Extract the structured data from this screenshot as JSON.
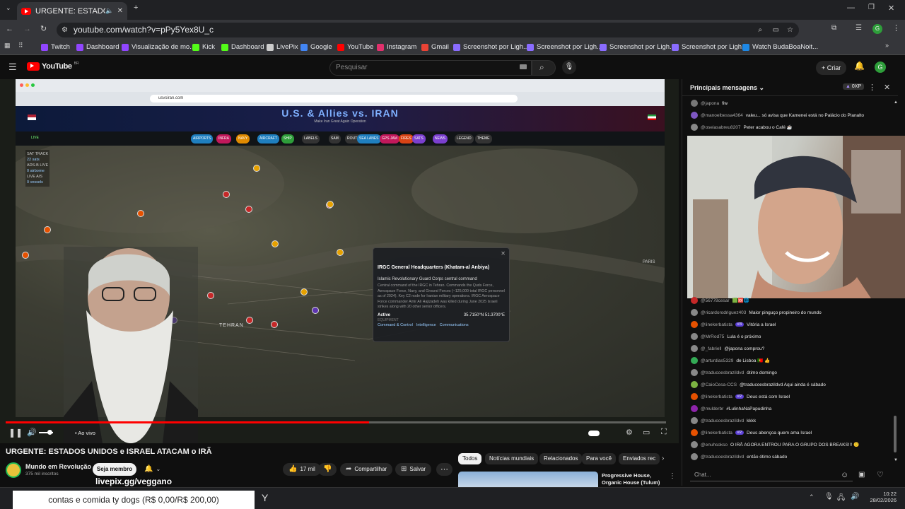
{
  "browser": {
    "tab_title": "URGENTE: ESTADOS UNIDOS",
    "url": "youtube.com/watch?v=pPy5Yex8U_c",
    "bookmarks": [
      {
        "label": "Twitch",
        "color": "#9146ff"
      },
      {
        "label": "Dashboard",
        "color": "#9146ff"
      },
      {
        "label": "Visualização de mo...",
        "color": "#9146ff"
      },
      {
        "label": "Kick",
        "color": "#53fc18"
      },
      {
        "label": "Dashboard",
        "color": "#53fc18"
      },
      {
        "label": "LivePix",
        "color": "#cccccc"
      },
      {
        "label": "Google",
        "color": "#4285f4"
      },
      {
        "label": "YouTube",
        "color": "#ff0000"
      },
      {
        "label": "Instagram",
        "color": "#e1306c"
      },
      {
        "label": "Gmail",
        "color": "#ea4335"
      },
      {
        "label": "Screenshot por Ligh...",
        "color": "#8a6cff"
      },
      {
        "label": "Screenshot por Ligh...",
        "color": "#8a6cff"
      },
      {
        "label": "Screenshot por Ligh...",
        "color": "#8a6cff"
      },
      {
        "label": "Screenshot por Ligh...",
        "color": "#8a6cff"
      },
      {
        "label": "Watch BudaBoaNoit...",
        "color": "#1e88e5"
      }
    ]
  },
  "youtube": {
    "logo": "YouTube",
    "search_placeholder": "Pesquisar",
    "create_label": "Criar",
    "account_initial": "G"
  },
  "stream": {
    "inner_url": "usvsiran.com",
    "map_title": "U.S. & Allies vs. IRAN",
    "map_subtitle": "Make Iran Great Again Operation",
    "live_label": "LIVE",
    "layer_pills": [
      {
        "label": "AIRPORTS",
        "color": "#1f7fbf"
      },
      {
        "label": "INFRA",
        "color": "#c2185b"
      },
      {
        "label": "NAVY",
        "color": "#e08a00"
      },
      {
        "label": "AIRCRAFT",
        "color": "#1f7fbf"
      },
      {
        "label": "SHIP",
        "color": "#2e9e3a"
      },
      {
        "label": "LABELS",
        "color": "#333333"
      },
      {
        "label": "SAM",
        "color": "#333333"
      },
      {
        "label": "ROUTES",
        "color": "#333333"
      },
      {
        "label": "SEA LANES",
        "color": "#1f7fbf"
      },
      {
        "label": "GPS JAM",
        "color": "#c2185b"
      },
      {
        "label": "FIRES",
        "color": "#d84315"
      },
      {
        "label": "SATS",
        "color": "#7b3fcf"
      },
      {
        "label": "NEWS",
        "color": "#7b3fcf"
      },
      {
        "label": "LEGEND",
        "color": "#333333"
      },
      {
        "label": "THEME",
        "color": "#333333"
      }
    ],
    "sat_track": "SAT TRACK",
    "sats_value": "22 sats",
    "adsb_label": "ADS-B LIVE",
    "airborne_value": "0 airborne",
    "ais_label": "LIVE AIS",
    "vessels_value": "0 vessels",
    "city_label": "TEHRAN",
    "paris_label": "PARIS",
    "popup": {
      "title": "IRGC General Headquarters (Khatam-al Anbiya)",
      "org": "Islamic Revolutionary Guard Corps central command",
      "body": "Central command of the IRGC in Tehran. Commands the Quds Force, Aerospace Force, Navy, and Ground Forces (~125,000 total IRGC personnel as of 2024). Key C2 node for Iranian military operations. IRGC Aerospace Force commander Amir Ali Hajizadeh was killed during June 2025 Israeli strikes along with 20 other senior officers.",
      "status": "Active",
      "coords": "35.7150°N 51.3700°E",
      "equipment_label": "EQUIPMENT",
      "equipment": [
        "Command & Control",
        "Intelligence",
        "Communications"
      ]
    }
  },
  "player": {
    "live_label": "• Ao vivo",
    "progress": 0.55
  },
  "video": {
    "title": "URGENTE: ESTADOS UNIDOS e ISRAEL ATACAM o IRÃ",
    "channel": "Mundo em Revolução",
    "subscribers": "375 mil inscritos",
    "join_label": "Seja membro",
    "likes": "17 mil",
    "share_label": "Compartilhar",
    "save_label": "Salvar"
  },
  "related_chips": [
    "Todos",
    "Notícias mundiais",
    "Relacionados",
    "Para você",
    "Enviados rec"
  ],
  "related_video": {
    "title": "Progressive House, Organic House (Tulum)"
  },
  "overlay": {
    "livepix": "livepix.gg/veggano",
    "donation": "contas e comida ty dogs (R$ 0,00/R$ 200,00)"
  },
  "chat": {
    "header": "Principais mensagens",
    "points": "0XP",
    "input_placeholder": "Chat...",
    "messages_top": [
      {
        "author": "@japona",
        "text": "fiw",
        "color": "#777"
      },
      {
        "author": "@manoelbessa4364",
        "text": "valeu... só avisa que Kamenei está no Palácio do Planalto",
        "color": "#7e57c2"
      },
      {
        "author": "@oseiasabreu8207",
        "text": "Peter acabou o Café ☕",
        "color": "#888"
      }
    ],
    "messages": [
      {
        "author": "@56778cesar",
        "text": "",
        "badges": "🟩🆘🌐",
        "color": "#c62828"
      },
      {
        "author": "@ricardorodriguez403",
        "text": "Maior pinguço propineiro do mundo",
        "color": "#888"
      },
      {
        "author": "@linekerbatista",
        "badge": "#3",
        "text": "Vitória a Israel",
        "color": "#e65100"
      },
      {
        "author": "@MrRod75",
        "text": "Lula é o próximo",
        "color": "#888"
      },
      {
        "author": "@_fabriell",
        "text": "@japona comprou?",
        "color": "#888"
      },
      {
        "author": "@arturdias5329",
        "text": "de Lisboa 🇵🇹 👍",
        "color": "#3a5"
      },
      {
        "author": "@traducoesbrazildvd",
        "text": "ótimo domingo",
        "color": "#888"
      },
      {
        "author": "@CaioCesa-CCS",
        "text": "@traducoesbrazildvd Aqui ainda é sábado",
        "color": "#7cb342"
      },
      {
        "author": "@linekerbatista",
        "badge": "#2",
        "text": "Deus está com Israel",
        "color": "#e65100"
      },
      {
        "author": "@mulderbr",
        "text": "#LulinhaNaPapudinha",
        "color": "#8e24aa"
      },
      {
        "author": "@traducoesbrazildvd",
        "text": "kkkk",
        "color": "#888"
      },
      {
        "author": "@linekerbatista",
        "badge": "#2",
        "text": "Deus abençoa quem ama Israel",
        "color": "#e65100"
      },
      {
        "author": "@enuhsokso",
        "text": "O IRÃ AGORA ENTROU PARA O GRUPO DOS BREAKS!!! 🙂",
        "color": "#888"
      },
      {
        "author": "@traducoesbrazildvd",
        "text": "então ótimo sábado",
        "color": "#888"
      }
    ]
  },
  "taskbar": {
    "time": "10:22",
    "date": "28/02/2026"
  }
}
